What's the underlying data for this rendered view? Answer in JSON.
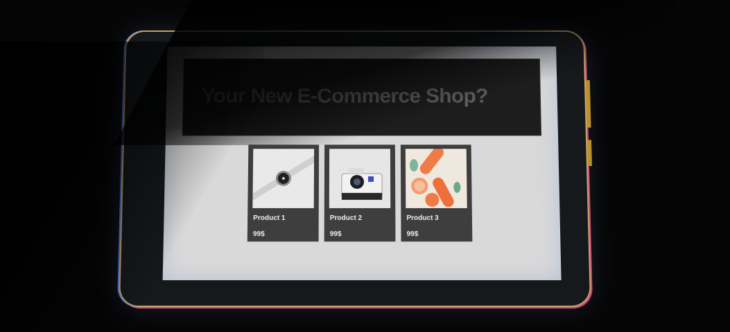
{
  "hero": {
    "title": "Your New E-Commerce Shop?"
  },
  "products": [
    {
      "name": "Product 1",
      "price": "99$",
      "image_icon": "watch-icon"
    },
    {
      "name": "Product 2",
      "price": "99$",
      "image_icon": "camera-icon"
    },
    {
      "name": "Product 3",
      "price": "99$",
      "image_icon": "grapefruit-icon"
    }
  ],
  "colors": {
    "screen_bg": "#d9d9d9",
    "hero_bg": "#1d1d1d",
    "card_bg": "#3e3e3e"
  }
}
